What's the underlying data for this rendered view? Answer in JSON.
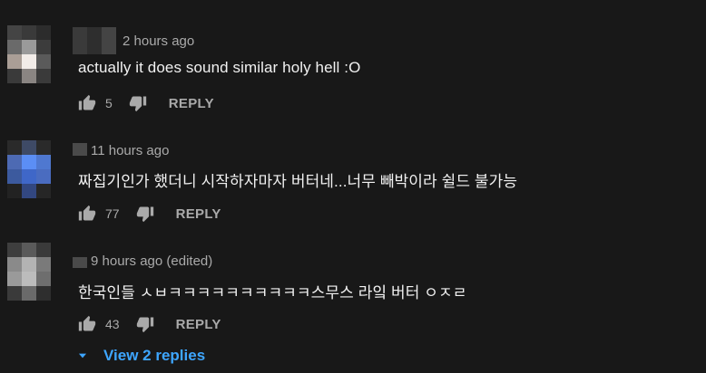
{
  "comments": [
    {
      "timestamp": "2 hours ago",
      "text": "actually it does sound similar holy hell :O",
      "like_count": "5",
      "reply_label": "REPLY",
      "avatar_palette": [
        "#444444",
        "#3a3a3a",
        "#2c2c2c",
        "#6a6a6a",
        "#9a9a9a",
        "#3c3c3c",
        "#aa9e96",
        "#f2ece8",
        "#5a5a5a",
        "#3a3a3a",
        "#8a8582",
        "#3a3a3a"
      ],
      "author_palette": [
        "#3a3a3a",
        "#2e2e2e",
        "#444444"
      ]
    },
    {
      "timestamp": "11 hours ago",
      "text": "짜집기인가 했더니 시작하자마자 버터네...너무 빼박이라 쉴드 불가능",
      "like_count": "77",
      "reply_label": "REPLY",
      "avatar_palette": [
        "#2a2a2a",
        "#3e4a66",
        "#2a2a2a",
        "#4d6ab3",
        "#5b8ef5",
        "#4f78d0",
        "#3c5a9e",
        "#3f67c8",
        "#4a6cc0",
        "#222222",
        "#324780",
        "#262626"
      ],
      "author_palette": [
        "#4a4a4a"
      ]
    },
    {
      "timestamp": "9 hours ago (edited)",
      "text": "한국인들 ㅅㅂㅋㅋㅋㅋㅋㅋㅋㅋㅋㅋ스무스 라잌 버터 ㅇㅈㄹ",
      "like_count": "43",
      "reply_label": "REPLY",
      "avatar_palette": [
        "#3e3e3e",
        "#5a5a5a",
        "#3a3a3a",
        "#8a8a8a",
        "#b3b3b3",
        "#7a7a7a",
        "#9a9a9a",
        "#bcbcbc",
        "#6e6e6e",
        "#3a3a3a",
        "#6a6a6a",
        "#2e2e2e"
      ],
      "author_palette": [
        "#4a4a4a"
      ]
    }
  ],
  "view_replies": {
    "label": "View 2 replies",
    "color": "#3ea6ff"
  },
  "icons": {
    "like": "thumbs-up-icon",
    "dislike": "thumbs-down-icon",
    "expand": "chevron-down-icon"
  },
  "colors": {
    "background": "#181818",
    "primary_text": "#f1f1f1",
    "secondary_text": "#aaaaaa",
    "accent": "#3ea6ff"
  }
}
